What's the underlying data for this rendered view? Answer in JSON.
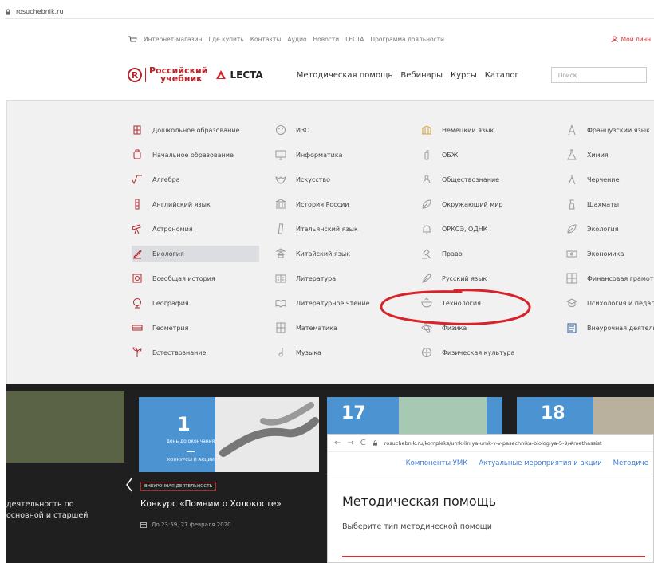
{
  "browser": {
    "url": "rosuchebnik.ru"
  },
  "toplinks": {
    "items": [
      "Интернет-магазин",
      "Где купить",
      "Контакты",
      "Аудио",
      "Новости",
      "LECTA",
      "Программа лояльности"
    ],
    "account": "Мой личн"
  },
  "header": {
    "logo_line1": "Российский",
    "logo_line2": "учебник",
    "lecta": "LECTA",
    "nav": [
      "Методическая помощь",
      "Вебинары",
      "Курсы",
      "Каталог"
    ],
    "search_placeholder": "Поиск"
  },
  "subjects": {
    "col1": [
      "Дошкольное образование",
      "Начальное образование",
      "Алгебра",
      "Английский язык",
      "Астрономия",
      "Биология",
      "Всеобщая история",
      "География",
      "Геометрия",
      "Естествознание"
    ],
    "col2": [
      "ИЗО",
      "Информатика",
      "Искусство",
      "История России",
      "Итальянский язык",
      "Китайский язык",
      "Литература",
      "Литературное чтение",
      "Математика",
      "Музыка"
    ],
    "col3": [
      "Немецкий язык",
      "ОБЖ",
      "Обществознание",
      "Окружающий мир",
      "ОРКСЭ, ОДНК",
      "Право",
      "Русский язык",
      "Технология",
      "Физика",
      "Физическая культура"
    ],
    "col4": [
      "Французский язык",
      "Химия",
      "Черчение",
      "Шахматы",
      "Экология",
      "Экономика",
      "Финансовая грамотн",
      "Психология и педаго",
      "Внеурочная деятельн"
    ],
    "active": "Биология",
    "highlighted": "Технология",
    "accent_color": "#b3282d",
    "highlight_circle_color": "#d8232a"
  },
  "news": {
    "left_text_line1": "деятельность по",
    "left_text_line2": "основной и старшей",
    "card1_number": "1",
    "card1_caption": "день до окончания",
    "card1_caption2": "КОНКУРСЫ И АКЦИИ",
    "card_tag": "ВНЕУРОЧНАЯ ДЕЯТЕЛЬНОСТЬ",
    "card_title": "Конкурс «Помним о Холокосте»",
    "card_date": "До 23:59, 27 февраля 2020",
    "card2_number": "17",
    "card3_number": "18"
  },
  "overlay": {
    "url": "rosuchebnik.ru/kompleks/umk-liniya-umk-v-v-pasechnika-biologiya-5-9/#methassist",
    "tabs": [
      "Компоненты УМК",
      "Актуальные мероприятия и акции",
      "Методиче"
    ],
    "title": "Методическая помощь",
    "subtitle": "Выберите тип методической помощи"
  }
}
